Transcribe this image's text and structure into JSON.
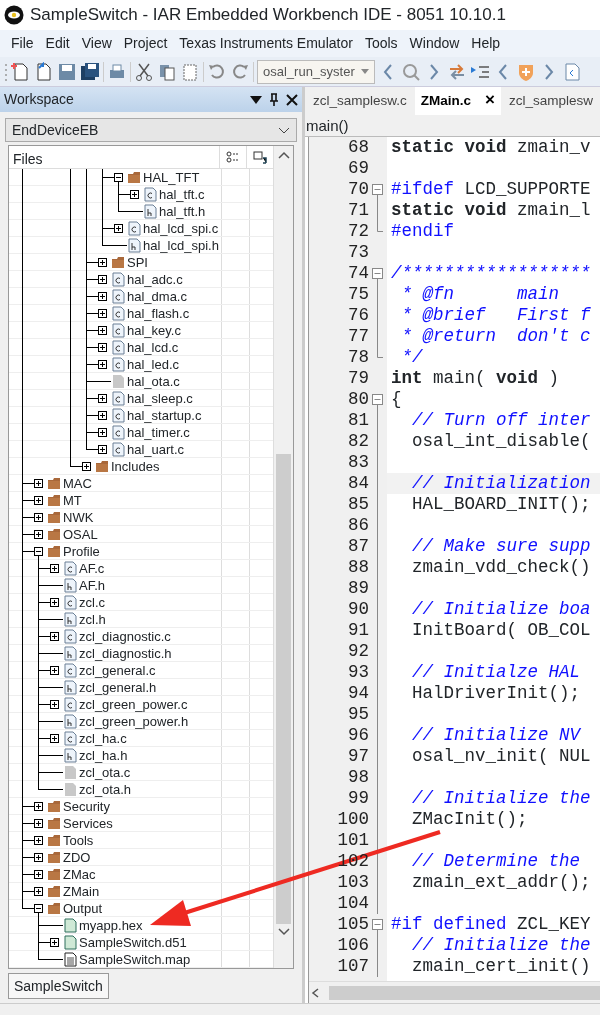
{
  "window": {
    "title": "SampleSwitch - IAR Embedded Workbench IDE - 8051 10.10.1"
  },
  "menu": [
    "File",
    "Edit",
    "View",
    "Project",
    "Texas Instruments Emulator",
    "Tools",
    "Window",
    "Help"
  ],
  "toolbar": {
    "combo": "osal_run_syster"
  },
  "workspace": {
    "title": "Workspace",
    "configuration": "EndDeviceEB",
    "column": "Files",
    "tree": [
      {
        "children": [
          {
            "children": [
              {
                "children": [
                  {
                    "children": [
                      {
                        "children": [
                          {
                            "label": "HAL_TFT",
                            "kind": "folder",
                            "expanded": true,
                            "children": [
                              {
                                "label": "hal_tft.c",
                                "kind": "c",
                                "expanded": false
                              },
                              {
                                "label": "hal_tft.h",
                                "kind": "h"
                              }
                            ]
                          },
                          {
                            "label": "hal_lcd_spi.c",
                            "kind": "c",
                            "expanded": false
                          },
                          {
                            "label": "hal_lcd_spi.h",
                            "kind": "h"
                          }
                        ]
                      },
                      {
                        "label": "SPI",
                        "kind": "folder",
                        "expanded": false
                      },
                      {
                        "label": "hal_adc.c",
                        "kind": "c",
                        "expanded": false
                      },
                      {
                        "label": "hal_dma.c",
                        "kind": "c",
                        "expanded": false
                      },
                      {
                        "label": "hal_flash.c",
                        "kind": "c",
                        "expanded": false
                      },
                      {
                        "label": "hal_key.c",
                        "kind": "c",
                        "expanded": false
                      },
                      {
                        "label": "hal_lcd.c",
                        "kind": "c",
                        "expanded": false
                      },
                      {
                        "label": "hal_led.c",
                        "kind": "c",
                        "expanded": false
                      },
                      {
                        "label": "hal_ota.c",
                        "kind": "blank"
                      },
                      {
                        "label": "hal_sleep.c",
                        "kind": "c",
                        "expanded": false
                      },
                      {
                        "label": "hal_startup.c",
                        "kind": "c",
                        "expanded": false
                      },
                      {
                        "label": "hal_timer.c",
                        "kind": "c",
                        "expanded": false
                      },
                      {
                        "label": "hal_uart.c",
                        "kind": "c",
                        "expanded": false
                      }
                    ]
                  },
                  {
                    "label": "Includes",
                    "kind": "folder",
                    "expanded": false
                  }
                ]
              }
            ]
          }
        ]
      },
      {
        "label": "MAC",
        "kind": "folder",
        "expanded": false
      },
      {
        "label": "MT",
        "kind": "folder",
        "expanded": false
      },
      {
        "label": "NWK",
        "kind": "folder",
        "expanded": false
      },
      {
        "label": "OSAL",
        "kind": "folder",
        "expanded": false
      },
      {
        "label": "Profile",
        "kind": "folder",
        "expanded": true,
        "children": [
          {
            "label": "AF.c",
            "kind": "c",
            "expanded": false
          },
          {
            "label": "AF.h",
            "kind": "h"
          },
          {
            "label": "zcl.c",
            "kind": "c",
            "expanded": false
          },
          {
            "label": "zcl.h",
            "kind": "h"
          },
          {
            "label": "zcl_diagnostic.c",
            "kind": "c",
            "expanded": false
          },
          {
            "label": "zcl_diagnostic.h",
            "kind": "h"
          },
          {
            "label": "zcl_general.c",
            "kind": "c",
            "expanded": false
          },
          {
            "label": "zcl_general.h",
            "kind": "h"
          },
          {
            "label": "zcl_green_power.c",
            "kind": "c",
            "expanded": false
          },
          {
            "label": "zcl_green_power.h",
            "kind": "h"
          },
          {
            "label": "zcl_ha.c",
            "kind": "c",
            "expanded": false
          },
          {
            "label": "zcl_ha.h",
            "kind": "h"
          },
          {
            "label": "zcl_ota.c",
            "kind": "blank"
          },
          {
            "label": "zcl_ota.h",
            "kind": "blank"
          }
        ]
      },
      {
        "label": "Security",
        "kind": "folder",
        "expanded": false
      },
      {
        "label": "Services",
        "kind": "folder",
        "expanded": false
      },
      {
        "label": "Tools",
        "kind": "folder",
        "expanded": false
      },
      {
        "label": "ZDO",
        "kind": "folder",
        "expanded": false
      },
      {
        "label": "ZMac",
        "kind": "folder",
        "expanded": false
      },
      {
        "label": "ZMain",
        "kind": "folder",
        "expanded": false
      },
      {
        "label": "Output",
        "kind": "folder",
        "expanded": true,
        "children": [
          {
            "label": "myapp.hex",
            "kind": "binary"
          },
          {
            "label": "SampleSwitch.d51",
            "kind": "binary",
            "expanded": false
          },
          {
            "label": "SampleSwitch.map",
            "kind": "text"
          }
        ]
      }
    ],
    "tabs": [
      {
        "label": "SampleSwitch",
        "selected": true
      }
    ]
  },
  "editor": {
    "tabs": [
      {
        "label": "zcl_samplesw.c",
        "selected": false
      },
      {
        "label": "ZMain.c",
        "selected": true,
        "close": "×"
      },
      {
        "label": "zcl_samplesw",
        "selected": false
      }
    ],
    "function": "main()",
    "lines": [
      {
        "number": "68",
        "segments": [
          {
            "text": "static void",
            "kind": "keyword"
          },
          {
            "text": " zmain_v"
          }
        ]
      },
      {
        "number": "69"
      },
      {
        "number": "70",
        "kind": "foldstart",
        "segments": [
          {
            "text": "#ifdef",
            "kind": "preproc"
          },
          {
            "text": " LCD_SUPPORTE"
          }
        ]
      },
      {
        "number": "71",
        "kind": "foldbody",
        "segments": [
          {
            "text": "static void",
            "kind": "keyword"
          },
          {
            "text": " zmain_l"
          }
        ]
      },
      {
        "number": "72",
        "kind": "foldend",
        "segments": [
          {
            "text": "#endif",
            "kind": "preproc"
          }
        ]
      },
      {
        "number": "73"
      },
      {
        "number": "74",
        "kind": "foldstart",
        "segments": [
          {
            "text": "/******************",
            "kind": "comment"
          }
        ]
      },
      {
        "number": "75",
        "kind": "foldbody",
        "segments": [
          {
            "text": " * @fn      main",
            "kind": "comment"
          }
        ]
      },
      {
        "number": "76",
        "kind": "foldbody",
        "segments": [
          {
            "text": " * @brief   First f",
            "kind": "comment"
          }
        ]
      },
      {
        "number": "77",
        "kind": "foldbody",
        "segments": [
          {
            "text": " * @return  don't c",
            "kind": "comment"
          }
        ]
      },
      {
        "number": "78",
        "kind": "foldend",
        "segments": [
          {
            "text": " */",
            "kind": "comment"
          }
        ]
      },
      {
        "number": "79",
        "segments": [
          {
            "text": "int",
            "kind": "keyword"
          },
          {
            "text": " main( "
          },
          {
            "text": "void",
            "kind": "keyword"
          },
          {
            "text": " )"
          }
        ]
      },
      {
        "number": "80",
        "kind": "foldstart",
        "segments": [
          {
            "text": "{"
          }
        ]
      },
      {
        "number": "81",
        "kind": "foldbody",
        "segments": [
          {
            "text": "  // Turn off inter",
            "kind": "comment"
          }
        ]
      },
      {
        "number": "82",
        "kind": "foldbody",
        "segments": [
          {
            "text": "  osal_int_disable("
          }
        ]
      },
      {
        "number": "83",
        "kind": "foldbody"
      },
      {
        "number": "84",
        "kind": "foldbody",
        "current": true,
        "segments": [
          {
            "text": "  // Initialization",
            "kind": "comment"
          }
        ]
      },
      {
        "number": "85",
        "kind": "foldbody",
        "segments": [
          {
            "text": "  HAL_BOARD_INIT();"
          }
        ]
      },
      {
        "number": "86",
        "kind": "foldbody"
      },
      {
        "number": "87",
        "kind": "foldbody",
        "segments": [
          {
            "text": "  // Make sure supp",
            "kind": "comment"
          }
        ]
      },
      {
        "number": "88",
        "kind": "foldbody",
        "segments": [
          {
            "text": "  zmain_vdd_check()"
          }
        ]
      },
      {
        "number": "89",
        "kind": "foldbody"
      },
      {
        "number": "90",
        "kind": "foldbody",
        "segments": [
          {
            "text": "  // Initialize boa",
            "kind": "comment"
          }
        ]
      },
      {
        "number": "91",
        "kind": "foldbody",
        "segments": [
          {
            "text": "  InitBoard( OB_COL"
          }
        ]
      },
      {
        "number": "92",
        "kind": "foldbody"
      },
      {
        "number": "93",
        "kind": "foldbody",
        "segments": [
          {
            "text": "  // Initialze HAL",
            "kind": "comment"
          }
        ]
      },
      {
        "number": "94",
        "kind": "foldbody",
        "segments": [
          {
            "text": "  HalDriverInit();"
          }
        ]
      },
      {
        "number": "95",
        "kind": "foldbody"
      },
      {
        "number": "96",
        "kind": "foldbody",
        "segments": [
          {
            "text": "  // Initialize NV",
            "kind": "comment"
          }
        ]
      },
      {
        "number": "97",
        "kind": "foldbody",
        "segments": [
          {
            "text": "  osal_nv_init( NUL"
          }
        ]
      },
      {
        "number": "98",
        "kind": "foldbody"
      },
      {
        "number": "99",
        "kind": "foldbody",
        "segments": [
          {
            "text": "  // Initialize the",
            "kind": "comment"
          }
        ]
      },
      {
        "number": "100",
        "kind": "foldbody",
        "segments": [
          {
            "text": "  ZMacInit();"
          }
        ]
      },
      {
        "number": "101",
        "kind": "foldbody"
      },
      {
        "number": "102",
        "kind": "foldbody",
        "segments": [
          {
            "text": "  // Determine the",
            "kind": "comment"
          }
        ]
      },
      {
        "number": "103",
        "kind": "foldbody",
        "segments": [
          {
            "text": "  zmain_ext_addr();"
          }
        ]
      },
      {
        "number": "104",
        "kind": "foldbody"
      },
      {
        "number": "105",
        "kind": "foldstart",
        "segments": [
          {
            "text": "#if defined",
            "kind": "preproc"
          },
          {
            "text": " ZCL_KEY"
          }
        ]
      },
      {
        "number": "106",
        "kind": "foldbody",
        "segments": [
          {
            "text": "  // Initialize the",
            "kind": "comment"
          }
        ]
      },
      {
        "number": "107",
        "kind": "foldbody",
        "segments": [
          {
            "text": "  zmain_cert_init()"
          }
        ]
      }
    ]
  }
}
